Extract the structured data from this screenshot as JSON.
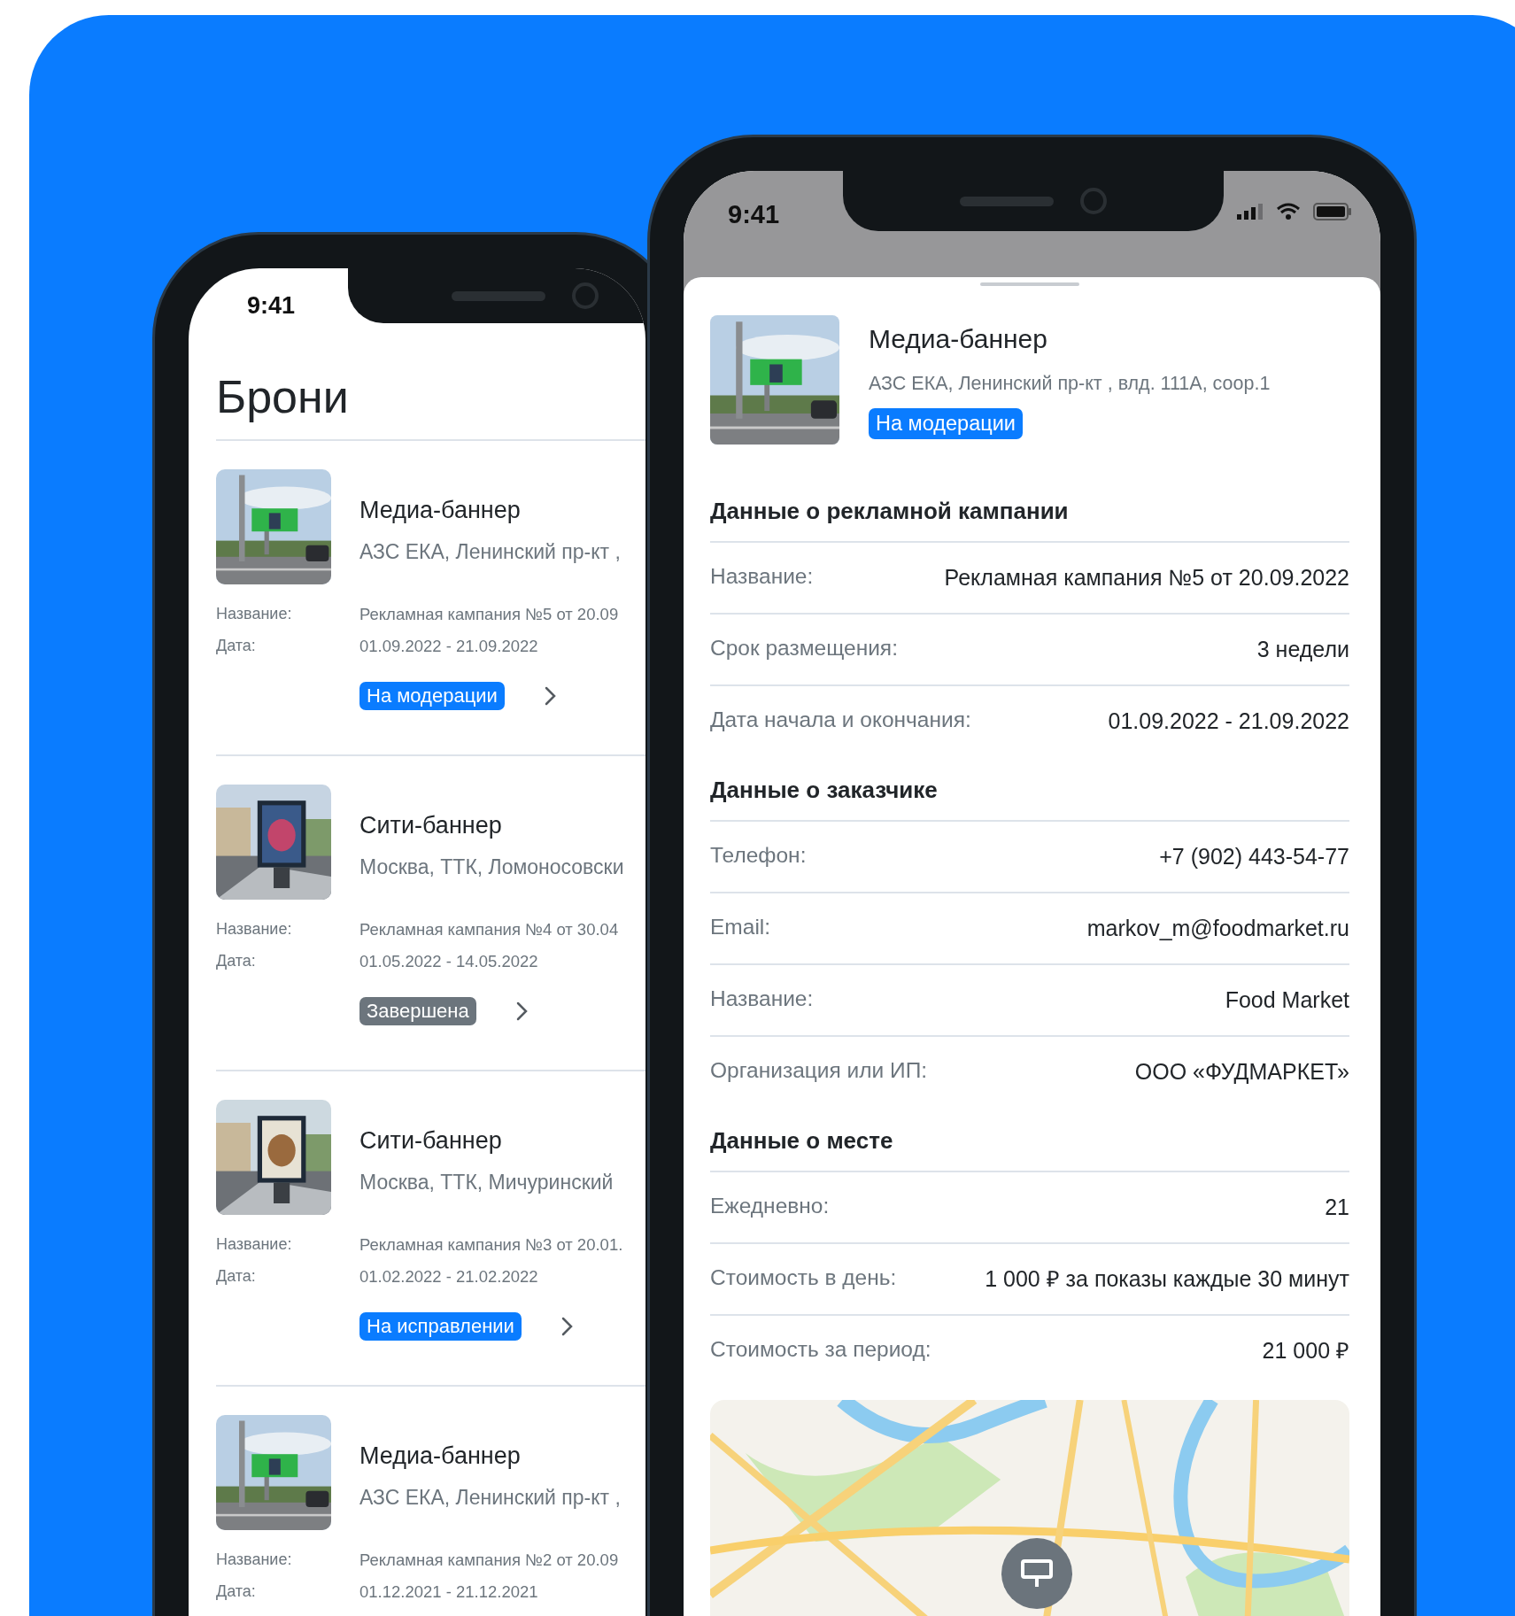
{
  "list_phone": {
    "status_time": "9:41",
    "title": "Брони",
    "bookings": [
      {
        "title": "Медиа-баннер",
        "address": "АЗС ЕКА, Ленинский пр-кт ,",
        "name_label": "Название:",
        "name_value": "Рекламная кампания №5 от 20.09",
        "date_label": "Дата:",
        "date_value": "01.09.2022 - 21.09.2022",
        "status": {
          "label": "На модерации",
          "color": "#0a7cff"
        }
      },
      {
        "title": "Сити-баннер",
        "address": "Москва, ТТК, Ломоносовски",
        "name_label": "Название:",
        "name_value": "Рекламная кампания №4 от 30.04",
        "date_label": "Дата:",
        "date_value": "01.05.2022 - 14.05.2022",
        "status": {
          "label": "Завершена",
          "color": "#6c757d"
        }
      },
      {
        "title": "Сити-баннер",
        "address": "Москва, ТТК, Мичуринский",
        "name_label": "Название:",
        "name_value": "Рекламная кампания №3 от 20.01.",
        "date_label": "Дата:",
        "date_value": "01.02.2022 - 21.02.2022",
        "status": {
          "label": "На исправлении",
          "color": "#0a7cff"
        }
      },
      {
        "title": "Медиа-баннер",
        "address": "АЗС ЕКА, Ленинский пр-кт ,",
        "name_label": "Название:",
        "name_value": "Рекламная кампания №2 от 20.09",
        "date_label": "Дата:",
        "date_value": "01.12.2021 - 21.12.2021"
      }
    ]
  },
  "detail_phone": {
    "status_time": "9:41",
    "header": {
      "title": "Медиа-баннер",
      "address": "АЗС ЕКА, Ленинский пр-кт , влд. 111А, соор.1",
      "status": {
        "label": "На модерации",
        "color": "#0a7cff"
      }
    },
    "sections": [
      {
        "title": "Данные о рекламной кампании",
        "rows": [
          {
            "label": "Название:",
            "value": "Рекламная кампания №5 от 20.09.2022"
          },
          {
            "label": "Срок размещения:",
            "value": "3 недели"
          },
          {
            "label": "Дата начала и окончания:",
            "value": "01.09.2022 - 21.09.2022"
          }
        ]
      },
      {
        "title": "Данные о заказчике",
        "rows": [
          {
            "label": "Телефон:",
            "value": "+7 (902) 443-54-77"
          },
          {
            "label": "Email:",
            "value": "markov_m@foodmarket.ru"
          },
          {
            "label": "Название:",
            "value": "Food Market"
          },
          {
            "label": "Организация или ИП:",
            "value": "ООО «ФУДМАРКЕТ»"
          }
        ]
      },
      {
        "title": "Данные о месте",
        "rows": [
          {
            "label": "Ежедневно:",
            "value": "21"
          },
          {
            "label": "Стоимость в день:",
            "value": "1 000 ₽ за показы каждые 30 минут"
          },
          {
            "label": "Стоимость за период:",
            "value": "21 000 ₽"
          }
        ]
      }
    ]
  }
}
